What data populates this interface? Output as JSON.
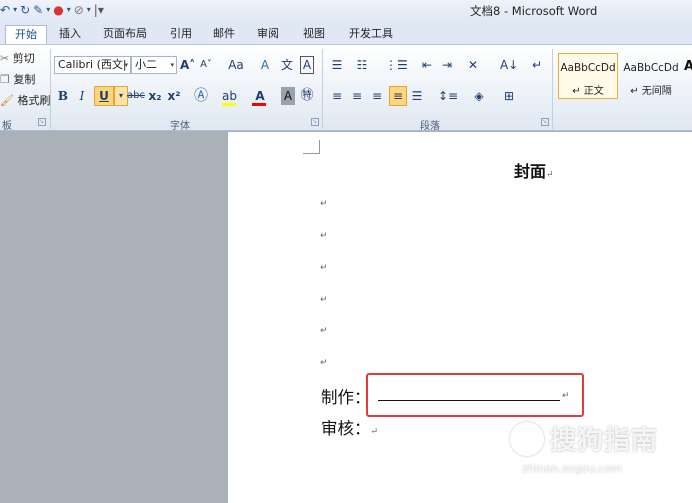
{
  "window": {
    "title": "文档8 - Microsoft Word"
  },
  "quick_access": {
    "icons": [
      "undo-icon",
      "redo-icon",
      "format-painter-icon",
      "chrome-icon",
      "theme-icon",
      "customize-icon"
    ]
  },
  "tabs": [
    "开始",
    "插入",
    "页面布局",
    "引用",
    "邮件",
    "审阅",
    "视图",
    "开发工具"
  ],
  "active_tab": "开始",
  "clipboard": {
    "cut": "剪切",
    "copy": "复制",
    "format_painter": "格式刷",
    "group": "板"
  },
  "font": {
    "name": "Calibri (西文|",
    "size": "小二",
    "group": "字体",
    "bold": "B",
    "italic": "I",
    "underline": "U",
    "strike": "abc",
    "subscript": "x₂",
    "superscript": "x²",
    "grow": "A˄",
    "shrink": "A˅",
    "case": "Aa",
    "clear": "A",
    "phonetic": "文",
    "border": "A",
    "highlight_color": "#ffff00",
    "font_color": "#ff0000",
    "char_shading": "A",
    "enclosed": "字"
  },
  "paragraph": {
    "group": "段落"
  },
  "styles": [
    {
      "preview": "AaBbCcDd",
      "name": "↵ 正文",
      "selected": true
    },
    {
      "preview": "AaBbCcDd",
      "name": "↵ 无间隔",
      "selected": false
    }
  ],
  "document": {
    "heading": "封面",
    "para_mark": "↵",
    "line1_label": "制作：",
    "line2_label": "审核："
  },
  "watermark": {
    "text": "搜狗指南",
    "url": "zhinan.sogou.com"
  },
  "colors": {
    "accent": "#1f4e9a",
    "highlight_box": "#e03c3c"
  }
}
